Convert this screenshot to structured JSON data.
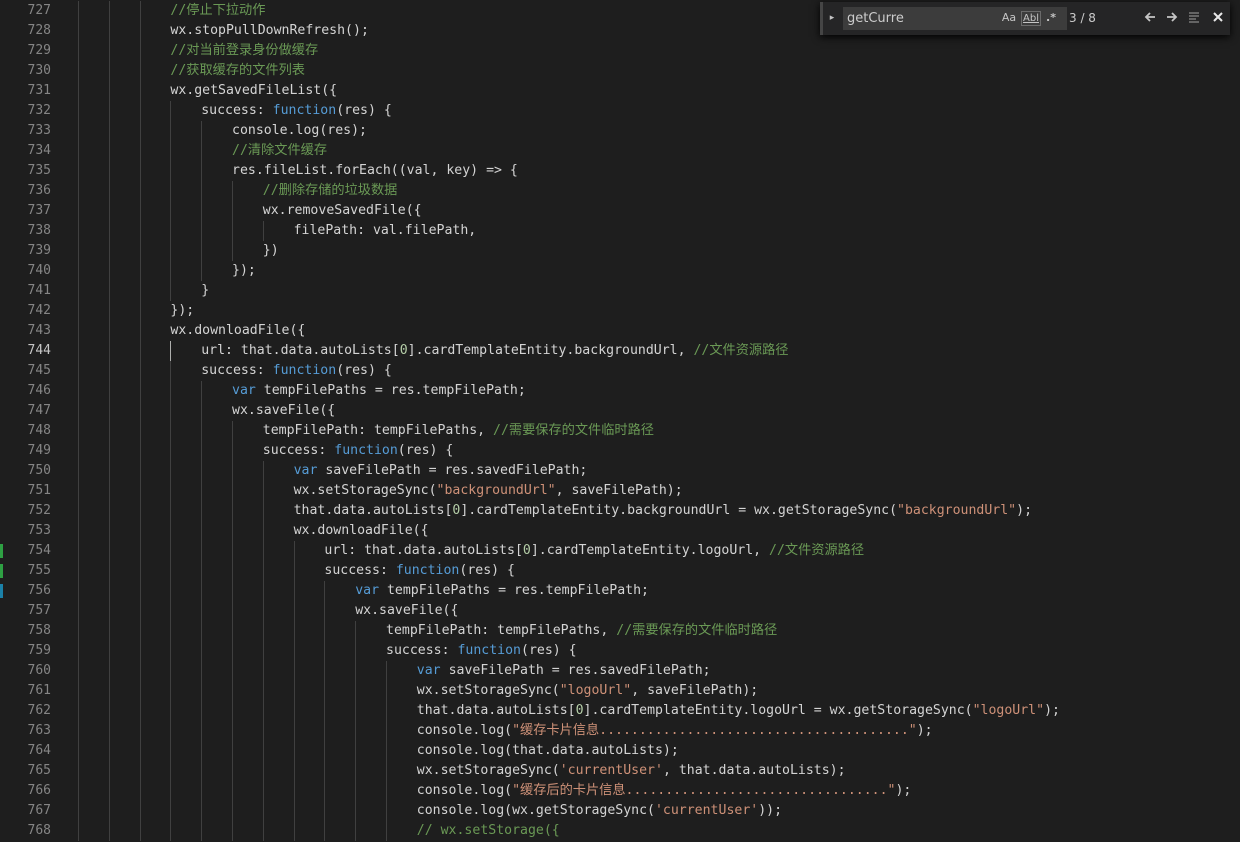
{
  "find_widget": {
    "query": "getCurre",
    "match_count": "3 / 8",
    "toggle_icon": "▸",
    "match_case_label": "Aa",
    "whole_word_label": "Abl",
    "regex_label": ".*",
    "prev_icon": "🡐",
    "next_icon": "🡒",
    "selection_icon": "≡",
    "close_icon": "✕"
  },
  "editor": {
    "active_line": 744,
    "lines": [
      {
        "num": 727,
        "indent": 3,
        "tokens": [
          [
            "c",
            "//停止下拉动作"
          ]
        ]
      },
      {
        "num": 728,
        "indent": 3,
        "tokens": [
          [
            "d",
            "wx.stopPullDownRefresh();"
          ]
        ]
      },
      {
        "num": 729,
        "indent": 3,
        "tokens": [
          [
            "c",
            "//对当前登录身份做缓存"
          ]
        ]
      },
      {
        "num": 730,
        "indent": 3,
        "tokens": [
          [
            "c",
            "//获取缓存的文件列表"
          ]
        ]
      },
      {
        "num": 731,
        "indent": 3,
        "tokens": [
          [
            "d",
            "wx.getSavedFileList({"
          ]
        ]
      },
      {
        "num": 732,
        "indent": 4,
        "tokens": [
          [
            "d",
            "success: "
          ],
          [
            "k",
            "function"
          ],
          [
            "d",
            "(res) {"
          ]
        ]
      },
      {
        "num": 733,
        "indent": 5,
        "tokens": [
          [
            "d",
            "console.log(res);"
          ]
        ]
      },
      {
        "num": 734,
        "indent": 5,
        "tokens": [
          [
            "c",
            "//清除文件缓存"
          ]
        ]
      },
      {
        "num": 735,
        "indent": 5,
        "tokens": [
          [
            "d",
            "res.fileList.forEach((val, key) => {"
          ]
        ]
      },
      {
        "num": 736,
        "indent": 6,
        "tokens": [
          [
            "c",
            "//删除存储的垃圾数据"
          ]
        ]
      },
      {
        "num": 737,
        "indent": 6,
        "tokens": [
          [
            "d",
            "wx.removeSavedFile({"
          ]
        ]
      },
      {
        "num": 738,
        "indent": 7,
        "tokens": [
          [
            "d",
            "filePath: val.filePath,"
          ]
        ]
      },
      {
        "num": 739,
        "indent": 6,
        "tokens": [
          [
            "d",
            "})"
          ]
        ]
      },
      {
        "num": 740,
        "indent": 5,
        "tokens": [
          [
            "d",
            "});"
          ]
        ]
      },
      {
        "num": 741,
        "indent": 4,
        "tokens": [
          [
            "d",
            "}"
          ]
        ]
      },
      {
        "num": 742,
        "indent": 3,
        "tokens": [
          [
            "d",
            "});"
          ]
        ]
      },
      {
        "num": 743,
        "indent": 3,
        "tokens": [
          [
            "d",
            "wx.downloadFile({"
          ]
        ]
      },
      {
        "num": 744,
        "indent": 4,
        "tokens": [
          [
            "d",
            "url: that.data.autoLists["
          ],
          [
            "n",
            "0"
          ],
          [
            "d",
            "].cardTemplateEntity.backgroundUrl, "
          ],
          [
            "c",
            "//文件资源路径"
          ]
        ]
      },
      {
        "num": 745,
        "indent": 4,
        "tokens": [
          [
            "d",
            "success: "
          ],
          [
            "k",
            "function"
          ],
          [
            "d",
            "(res) {"
          ]
        ]
      },
      {
        "num": 746,
        "indent": 5,
        "tokens": [
          [
            "k",
            "var"
          ],
          [
            "d",
            " tempFilePaths = res.tempFilePath;"
          ]
        ]
      },
      {
        "num": 747,
        "indent": 5,
        "tokens": [
          [
            "d",
            "wx.saveFile({"
          ]
        ]
      },
      {
        "num": 748,
        "indent": 6,
        "tokens": [
          [
            "d",
            "tempFilePath: tempFilePaths, "
          ],
          [
            "c",
            "//需要保存的文件临时路径"
          ]
        ]
      },
      {
        "num": 749,
        "indent": 6,
        "tokens": [
          [
            "d",
            "success: "
          ],
          [
            "k",
            "function"
          ],
          [
            "d",
            "(res) {"
          ]
        ]
      },
      {
        "num": 750,
        "indent": 7,
        "tokens": [
          [
            "k",
            "var"
          ],
          [
            "d",
            " saveFilePath = res.savedFilePath;"
          ]
        ]
      },
      {
        "num": 751,
        "indent": 7,
        "tokens": [
          [
            "d",
            "wx.setStorageSync("
          ],
          [
            "s",
            "\"backgroundUrl\""
          ],
          [
            "d",
            ", saveFilePath);"
          ]
        ]
      },
      {
        "num": 752,
        "indent": 7,
        "tokens": [
          [
            "d",
            "that.data.autoLists["
          ],
          [
            "n",
            "0"
          ],
          [
            "d",
            "].cardTemplateEntity.backgroundUrl = wx.getStorageSync("
          ],
          [
            "s",
            "\"backgroundUrl\""
          ],
          [
            "d",
            ");"
          ]
        ]
      },
      {
        "num": 753,
        "indent": 7,
        "tokens": [
          [
            "d",
            "wx.downloadFile({"
          ]
        ]
      },
      {
        "num": 754,
        "indent": 8,
        "tokens": [
          [
            "d",
            "url: that.data.autoLists["
          ],
          [
            "n",
            "0"
          ],
          [
            "d",
            "].cardTemplateEntity.logoUrl, "
          ],
          [
            "c",
            "//文件资源路径"
          ]
        ]
      },
      {
        "num": 755,
        "indent": 8,
        "tokens": [
          [
            "d",
            "success: "
          ],
          [
            "k",
            "function"
          ],
          [
            "d",
            "(res) {"
          ]
        ]
      },
      {
        "num": 756,
        "indent": 9,
        "tokens": [
          [
            "k",
            "var"
          ],
          [
            "d",
            " tempFilePaths = res.tempFilePath;"
          ]
        ]
      },
      {
        "num": 757,
        "indent": 9,
        "tokens": [
          [
            "d",
            "wx.saveFile({"
          ]
        ]
      },
      {
        "num": 758,
        "indent": 10,
        "tokens": [
          [
            "d",
            "tempFilePath: tempFilePaths, "
          ],
          [
            "c",
            "//需要保存的文件临时路径"
          ]
        ]
      },
      {
        "num": 759,
        "indent": 10,
        "tokens": [
          [
            "d",
            "success: "
          ],
          [
            "k",
            "function"
          ],
          [
            "d",
            "(res) {"
          ]
        ]
      },
      {
        "num": 760,
        "indent": 11,
        "tokens": [
          [
            "k",
            "var"
          ],
          [
            "d",
            " saveFilePath = res.savedFilePath;"
          ]
        ]
      },
      {
        "num": 761,
        "indent": 11,
        "tokens": [
          [
            "d",
            "wx.setStorageSync("
          ],
          [
            "s",
            "\"logoUrl\""
          ],
          [
            "d",
            ", saveFilePath);"
          ]
        ]
      },
      {
        "num": 762,
        "indent": 11,
        "tokens": [
          [
            "d",
            "that.data.autoLists["
          ],
          [
            "n",
            "0"
          ],
          [
            "d",
            "].cardTemplateEntity.logoUrl = wx.getStorageSync("
          ],
          [
            "s",
            "\"logoUrl\""
          ],
          [
            "d",
            ");"
          ]
        ]
      },
      {
        "num": 763,
        "indent": 11,
        "tokens": [
          [
            "d",
            "console.log("
          ],
          [
            "s",
            "\"缓存卡片信息.......................................\""
          ],
          [
            "d",
            ");"
          ]
        ]
      },
      {
        "num": 764,
        "indent": 11,
        "tokens": [
          [
            "d",
            "console.log(that.data.autoLists);"
          ]
        ]
      },
      {
        "num": 765,
        "indent": 11,
        "tokens": [
          [
            "d",
            "wx.setStorageSync("
          ],
          [
            "s",
            "'currentUser'"
          ],
          [
            "d",
            ", that.data.autoLists);"
          ]
        ]
      },
      {
        "num": 766,
        "indent": 11,
        "tokens": [
          [
            "d",
            "console.log("
          ],
          [
            "s",
            "\"缓存后的卡片信息.................................\""
          ],
          [
            "d",
            ");"
          ]
        ]
      },
      {
        "num": 767,
        "indent": 11,
        "tokens": [
          [
            "d",
            "console.log(wx.getStorageSync("
          ],
          [
            "s",
            "'currentUser'"
          ],
          [
            "d",
            "));"
          ]
        ]
      },
      {
        "num": 768,
        "indent": 11,
        "tokens": [
          [
            "c",
            "// wx.setStorage({"
          ]
        ]
      }
    ],
    "gutter_marks": [
      {
        "line": 754,
        "color": "#2ea043"
      },
      {
        "line": 755,
        "color": "#2ea043"
      },
      {
        "line": 756,
        "color": "#1b81a8"
      }
    ]
  }
}
